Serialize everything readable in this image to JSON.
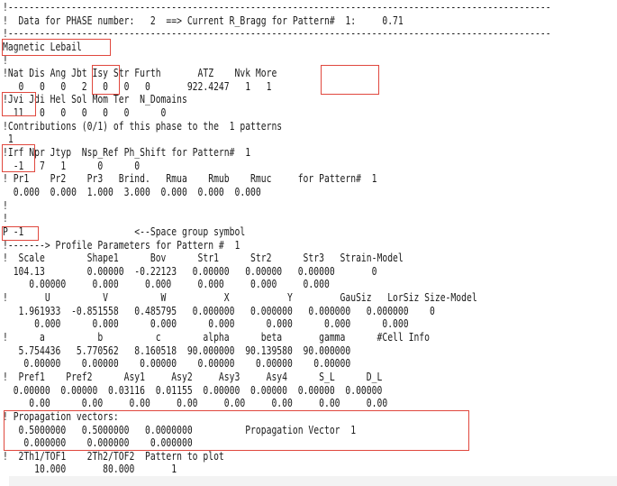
{
  "document": {
    "lines": [
      "!-------------------------------------------------------------------------------------------------------",
      "!  Data for PHASE number:   2  ==> Current R_Bragg for Pattern#  1:     0.71",
      "!-------------------------------------------------------------------------------------------------------",
      "Magnetic Lebail",
      "!",
      "!Nat Dis Ang Jbt Isy Str Furth       ATZ    Nvk More",
      "   0   0   0   2   0   0   0       922.4247   1   1",
      "!Jvi Jdi Hel Sol Mom Ter  N_Domains",
      "  11   0   0   0   0   0      0",
      "!Contributions (0/1) of this phase to the  1 patterns",
      " 1",
      "!Irf Npr Jtyp  Nsp_Ref Ph_Shift for Pattern#  1",
      "  -1   7   1      0      0",
      "! Pr1    Pr2    Pr3   Brind.   Rmua    Rmub    Rmuc     for Pattern#  1",
      "  0.000  0.000  1.000  3.000  0.000  0.000  0.000",
      "!",
      "!",
      "P -1                     <--Space group symbol",
      "!-------> Profile Parameters for Pattern #  1",
      "!  Scale        Shape1      Bov      Str1      Str2      Str3   Strain-Model",
      "  104.13        0.00000  -0.22123   0.00000   0.00000   0.00000       0",
      "     0.00000     0.000     0.000     0.000     0.000     0.000",
      "!       U          V          W           X           Y         GauSiz   LorSiz Size-Model",
      "   1.961933  -0.851558   0.485795   0.000000   0.000000   0.000000   0.000000    0",
      "      0.000      0.000      0.000      0.000      0.000      0.000      0.000",
      "!      a          b          c        alpha      beta       gamma      #Cell Info",
      "   5.754436   5.770562   8.160518  90.000000  90.139580  90.000000",
      "    0.00000    0.00000    0.00000    0.00000    0.00000    0.00000",
      "!  Pref1    Pref2      Asy1     Asy2     Asy3     Asy4      S_L      D_L",
      "  0.00000  0.00000  0.03116  0.01155  0.00000  0.00000  0.00000  0.00000",
      "     0.00      0.00     0.00     0.00     0.00     0.00     0.00     0.00",
      "! Propagation vectors:",
      "   0.5000000   0.5000000   0.0000000          Propagation Vector  1",
      "    0.000000    0.000000    0.000000",
      "!  2Th1/TOF1    2Th2/TOF2  Pattern to plot",
      "      10.000       80.000       1"
    ]
  },
  "highlight_color": "#e0483e"
}
